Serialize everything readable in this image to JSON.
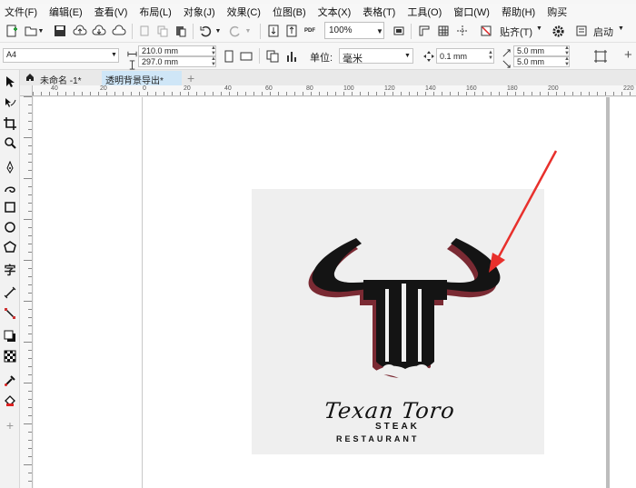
{
  "menubar": {
    "items": [
      "文件(F)",
      "编辑(E)",
      "查看(V)",
      "布局(L)",
      "对象(J)",
      "效果(C)",
      "位图(B)",
      "文本(X)",
      "表格(T)",
      "工具(O)",
      "窗口(W)",
      "帮助(H)",
      "购买"
    ]
  },
  "toolbar": {
    "zoom": "100%",
    "snap_label": "贴齐(T)",
    "launch_label": "启动",
    "pdf_label": "PDF"
  },
  "propbar": {
    "page_size": "A4",
    "width": "210.0 mm",
    "height": "297.0 mm",
    "units_label": "单位:",
    "units_value": "毫米",
    "nudge": "0.1 mm",
    "dup_x": "5.0 mm",
    "dup_y": "5.0 mm"
  },
  "tabs": [
    {
      "label": "未命名 -1*"
    },
    {
      "label": "透明背景导出*"
    }
  ],
  "ruler": {
    "labels": [
      "40",
      "20",
      "0",
      "20",
      "40",
      "60",
      "80",
      "100",
      "120",
      "140",
      "160",
      "180",
      "200",
      "220"
    ]
  },
  "logo": {
    "title": "Texan Toro",
    "line1": "STEAK",
    "line2": "RESTAURANT"
  },
  "colors": {
    "annotation_arrow": "#e8302c",
    "logo_shadow": "#7a2a33",
    "logo_fill": "#141414",
    "artboard": "#efefef",
    "active_tab": "#cfe6f7"
  }
}
